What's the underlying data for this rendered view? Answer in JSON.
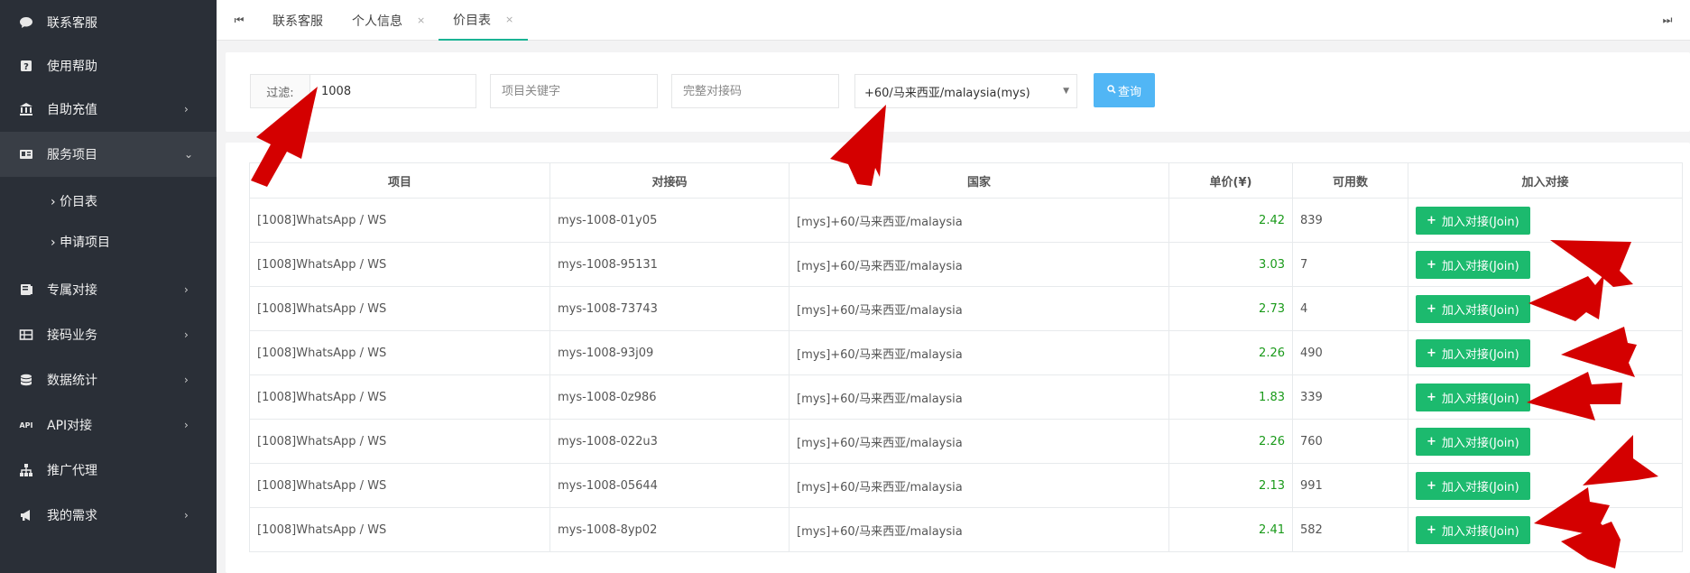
{
  "sidebar": {
    "items": [
      {
        "label": "联系客服",
        "icon": "chat-icon",
        "has_children": false
      },
      {
        "label": "使用帮助",
        "icon": "help-icon",
        "has_children": false
      },
      {
        "label": "自助充值",
        "icon": "bank-icon",
        "has_children": true
      },
      {
        "label": "服务项目",
        "icon": "idcard-icon",
        "has_children": true,
        "expanded": true
      },
      {
        "label": "专属对接",
        "icon": "book-icon",
        "has_children": true
      },
      {
        "label": "接码业务",
        "icon": "table-icon",
        "has_children": true
      },
      {
        "label": "数据统计",
        "icon": "database-icon",
        "has_children": true
      },
      {
        "label": "API对接",
        "icon": "api-icon",
        "has_children": true
      },
      {
        "label": "推广代理",
        "icon": "sitemap-icon",
        "has_children": false
      },
      {
        "label": "我的需求",
        "icon": "megaphone-icon",
        "has_children": true
      }
    ],
    "subitems": [
      {
        "label": "价目表",
        "active": true
      },
      {
        "label": "申请项目",
        "active": false
      }
    ]
  },
  "tabs": {
    "items": [
      {
        "label": "联系客服",
        "closable": false
      },
      {
        "label": "个人信息",
        "closable": true
      },
      {
        "label": "价目表",
        "closable": true,
        "active": true
      }
    ],
    "close_glyph": "×"
  },
  "filter": {
    "label": "过滤:",
    "value": "1008",
    "keyword_placeholder": "项目关键字",
    "code_placeholder": "完整对接码",
    "country_selected": "+60/马来西亚/malaysia(mys)",
    "search_label": "查询"
  },
  "table": {
    "headers": [
      "项目",
      "对接码",
      "国家",
      "单价(¥)",
      "可用数",
      "加入对接"
    ],
    "join_label": "加入对接(Join)",
    "rows": [
      {
        "project": "[1008]WhatsApp / WS",
        "code": "mys-1008-01y05",
        "country": "[mys]+60/马来西亚/malaysia",
        "price": "2.42",
        "available": "839"
      },
      {
        "project": "[1008]WhatsApp / WS",
        "code": "mys-1008-95131",
        "country": "[mys]+60/马来西亚/malaysia",
        "price": "3.03",
        "available": "7"
      },
      {
        "project": "[1008]WhatsApp / WS",
        "code": "mys-1008-73743",
        "country": "[mys]+60/马来西亚/malaysia",
        "price": "2.73",
        "available": "4"
      },
      {
        "project": "[1008]WhatsApp / WS",
        "code": "mys-1008-93j09",
        "country": "[mys]+60/马来西亚/malaysia",
        "price": "2.26",
        "available": "490"
      },
      {
        "project": "[1008]WhatsApp / WS",
        "code": "mys-1008-0z986",
        "country": "[mys]+60/马来西亚/malaysia",
        "price": "1.83",
        "available": "339"
      },
      {
        "project": "[1008]WhatsApp / WS",
        "code": "mys-1008-022u3",
        "country": "[mys]+60/马来西亚/malaysia",
        "price": "2.26",
        "available": "760"
      },
      {
        "project": "[1008]WhatsApp / WS",
        "code": "mys-1008-05644",
        "country": "[mys]+60/马来西亚/malaysia",
        "price": "2.13",
        "available": "991"
      },
      {
        "project": "[1008]WhatsApp / WS",
        "code": "mys-1008-8yp02",
        "country": "[mys]+60/马来西亚/malaysia",
        "price": "2.41",
        "available": "582"
      }
    ]
  },
  "colors": {
    "sidebar_bg": "#2a2f37",
    "join_button": "#1cba6e",
    "search_button": "#51b6f5",
    "price_text": "#1a9a1a",
    "annotation_arrow": "#d40000"
  }
}
